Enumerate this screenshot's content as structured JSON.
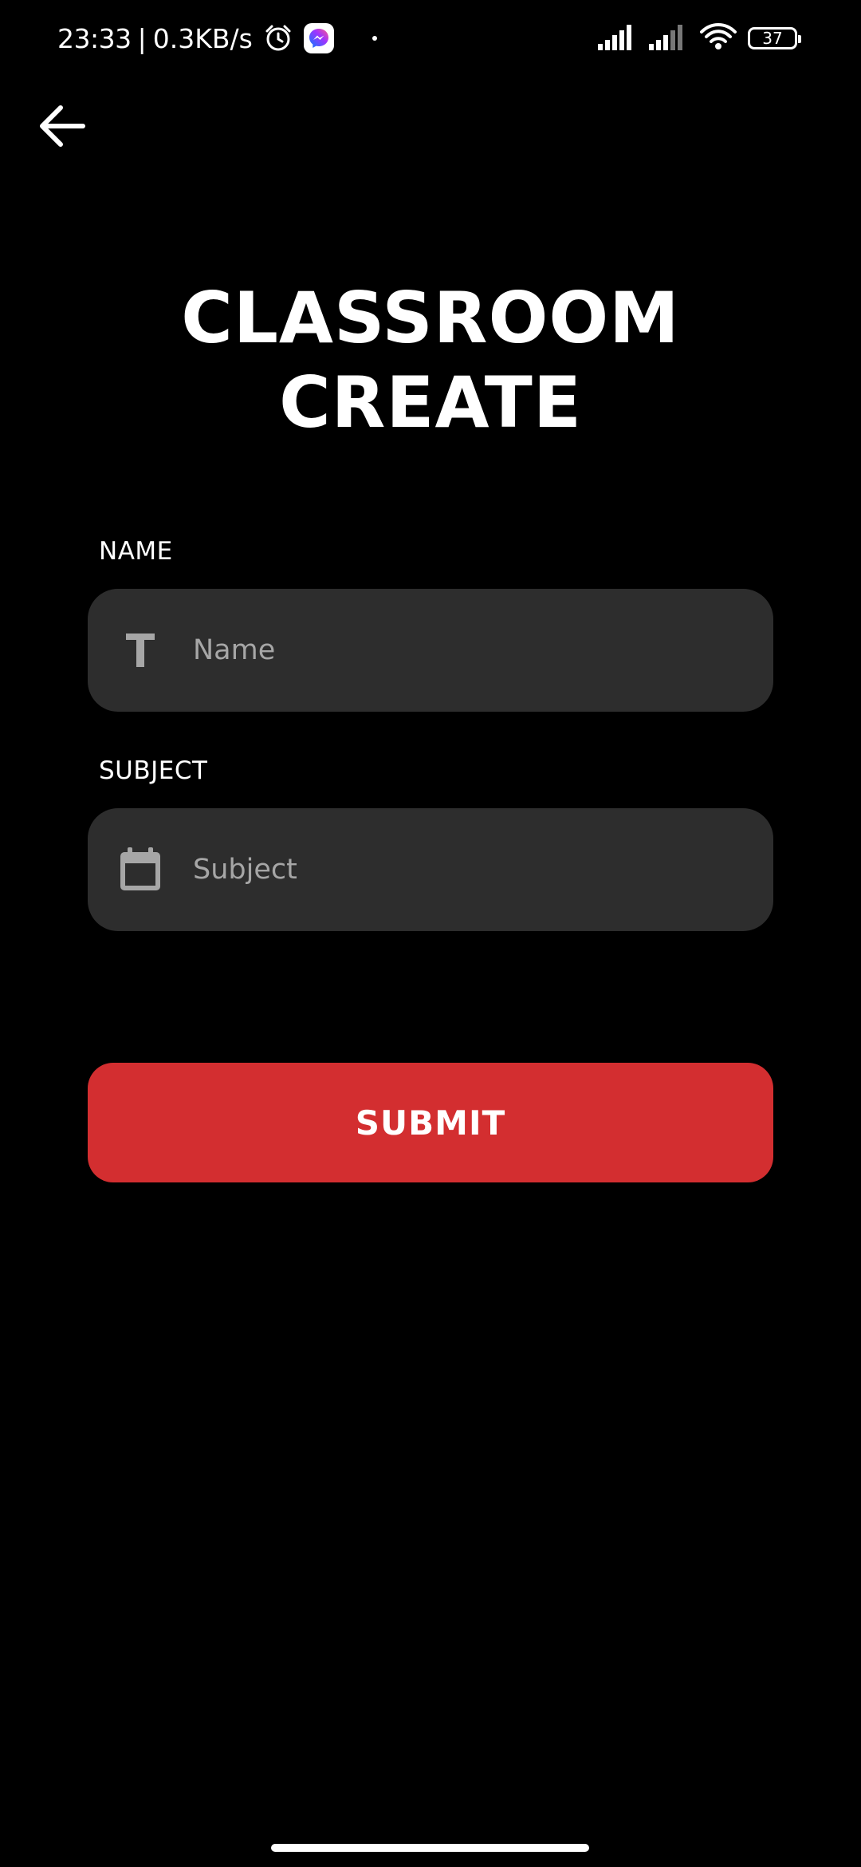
{
  "status_bar": {
    "time": "23:33",
    "separator": "|",
    "network_speed": "0.3KB/s",
    "battery_level": "37",
    "icons": [
      "alarm-icon",
      "messenger-icon",
      "dot-icon",
      "signal-icon",
      "signal-icon",
      "wifi-icon",
      "battery-icon"
    ]
  },
  "header": {
    "back_icon": "arrow-left-icon"
  },
  "title": {
    "line1": "CLASSROOM",
    "line2": "CREATE"
  },
  "form": {
    "name": {
      "label": "NAME",
      "placeholder": "Name",
      "value": "",
      "icon": "text-t-icon"
    },
    "subject": {
      "label": "SUBJECT",
      "placeholder": "Subject",
      "value": "",
      "icon": "calendar-icon"
    },
    "submit_label": "SUBMIT"
  },
  "colors": {
    "background": "#000000",
    "input_background": "#2d2d2d",
    "accent": "#d32e30",
    "placeholder": "#a6a6a6",
    "text": "#ffffff"
  }
}
